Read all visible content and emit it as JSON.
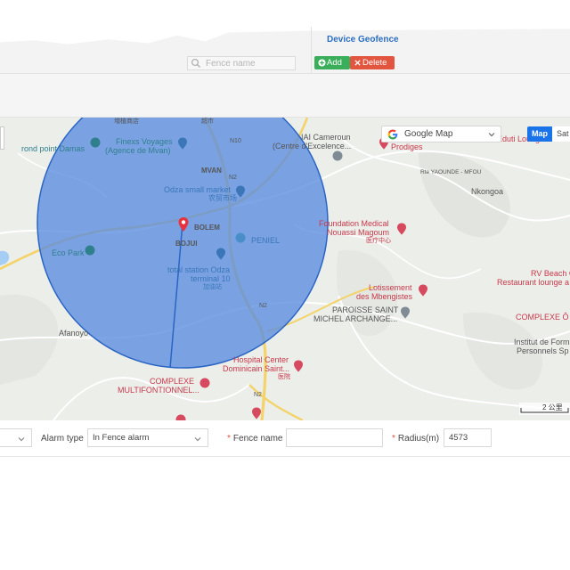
{
  "header": {
    "section_title": "Device Geofence",
    "fence_search_placeholder": "Fence name",
    "add_label": "Add",
    "delete_label": "Delete"
  },
  "map": {
    "map_type_selected": "Google Map",
    "map_button_label": "Map",
    "satellite_button_label": "Sat",
    "scale_label": "2 公里",
    "labels": [
      "増植商店",
      "超市",
      "Finexs Voyages",
      "(Agence de Mvan)",
      "rond point Damas",
      "N10",
      "MVAN",
      "N2",
      "Odza small market",
      "农贸市场",
      "BOLEM",
      "PENIEL",
      "BOJUI",
      "total station Odza",
      "terminal 10",
      "加油站",
      "Eco Park",
      "N2",
      "Afanoyo",
      "COMPLEXE",
      "MULTIFONTIONNEL...",
      "IAI Cameroun",
      "(Centre d'Excelence...",
      "Prodiges",
      "Rte YAOUNDE - MFOU",
      "Nkongoa",
      "Foundation Medical",
      "Nouassi Magoum",
      "医疗中心",
      "Lotissement",
      "des Mbengistes",
      "PAROISSE SAINT",
      "MICHEL ARCHANGE...",
      "COMPLEXE Ô",
      "Hospital Center",
      "Dominicain Saint...",
      "医院",
      "N2",
      "Eduti Lounge",
      "RV Beach C",
      "Restaurant lounge a",
      "Institut de Form",
      "Personnels Sp"
    ],
    "colors": {
      "circle_fill": "#5a8de0",
      "circle_stroke": "#2a64c4",
      "road_major": "#f5d76e",
      "water": "#a6cdf3",
      "land": "#eceeea"
    }
  },
  "form": {
    "alarm_type_label": "Alarm type",
    "alarm_type_value": "In Fence alarm",
    "fence_name_label": "Fence name",
    "fence_name_value": "",
    "radius_label": "Radius(m)",
    "radius_value": "4573",
    "required_mark": "*"
  }
}
